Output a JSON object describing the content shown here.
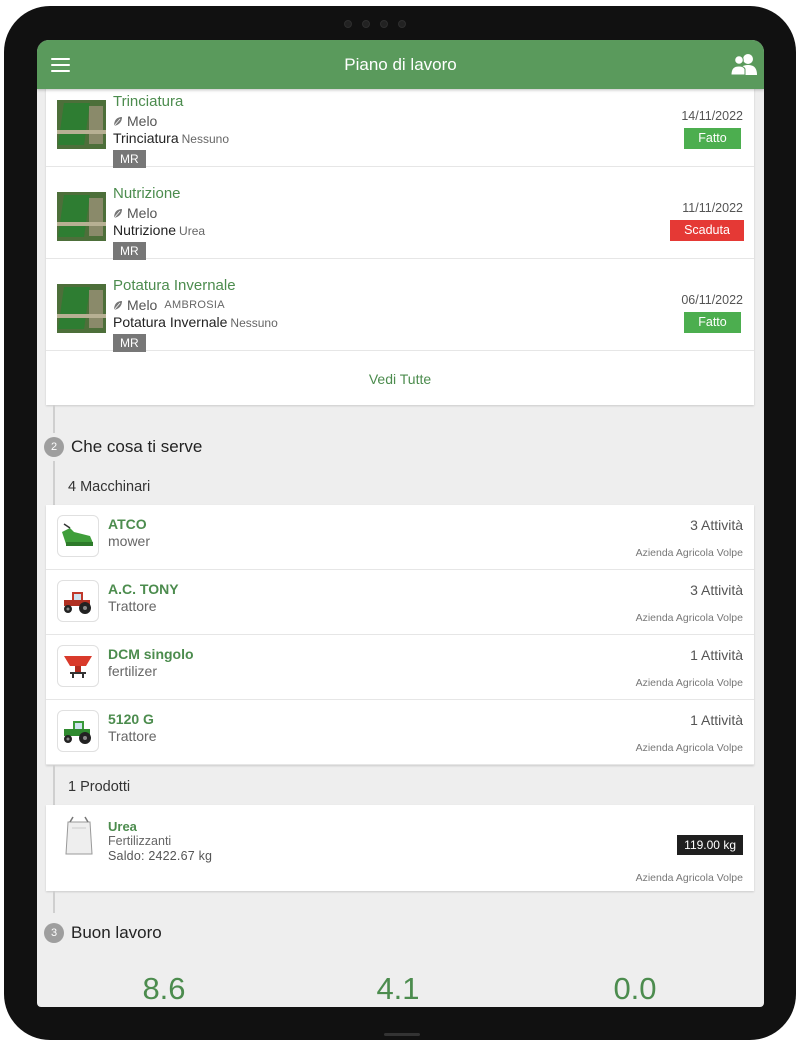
{
  "header": {
    "title": "Piano di lavoro"
  },
  "tasks": [
    {
      "title": "Trinciatura",
      "crop": "Melo",
      "variety": "",
      "operation": "Trinciatura",
      "operation_detail": "Nessuno",
      "tag": "MR",
      "date": "14/11/2022",
      "status": "Fatto"
    },
    {
      "title": "Nutrizione",
      "crop": "Melo",
      "variety": "",
      "operation": "Nutrizione",
      "operation_detail": "Urea",
      "tag": "MR",
      "date": "11/11/2022",
      "status": "Scaduta"
    },
    {
      "title": "Potatura Invernale",
      "crop": "Melo",
      "variety": "AMBROSIA",
      "operation": "Potatura Invernale",
      "operation_detail": "Nessuno",
      "tag": "MR",
      "date": "06/11/2022",
      "status": "Fatto"
    }
  ],
  "see_all_label": "Vedi Tutte",
  "step2": {
    "number": "2",
    "title": "Che cosa ti serve"
  },
  "machines_header": "4 Macchinari",
  "machines": [
    {
      "name": "ATCO",
      "type": "mower",
      "count": "3 Attività",
      "company": "Azienda Agricola Volpe",
      "icon": "mower-icon"
    },
    {
      "name": "A.C. TONY",
      "type": "Trattore",
      "count": "3 Attività",
      "company": "Azienda Agricola Volpe",
      "icon": "red-tractor-icon"
    },
    {
      "name": "DCM singolo",
      "type": "fertilizer",
      "count": "1 Attività",
      "company": "Azienda Agricola Volpe",
      "icon": "spreader-icon"
    },
    {
      "name": "5120 G",
      "type": "Trattore",
      "count": "1 Attività",
      "company": "Azienda Agricola Volpe",
      "icon": "green-tractor-icon"
    }
  ],
  "products_header": "1 Prodotti",
  "products": [
    {
      "name": "Urea",
      "category": "Fertilizzanti",
      "balance": "Saldo: 2422.67 kg",
      "quantity": "119.00 kg",
      "company": "Azienda Agricola Volpe"
    }
  ],
  "step3": {
    "number": "3",
    "title": "Buon lavoro"
  },
  "summary_values": [
    "8.6",
    "4.1",
    "0.0"
  ],
  "colors": {
    "primary": "#5a9a5c",
    "done": "#4cae4f",
    "late": "#e53935"
  }
}
